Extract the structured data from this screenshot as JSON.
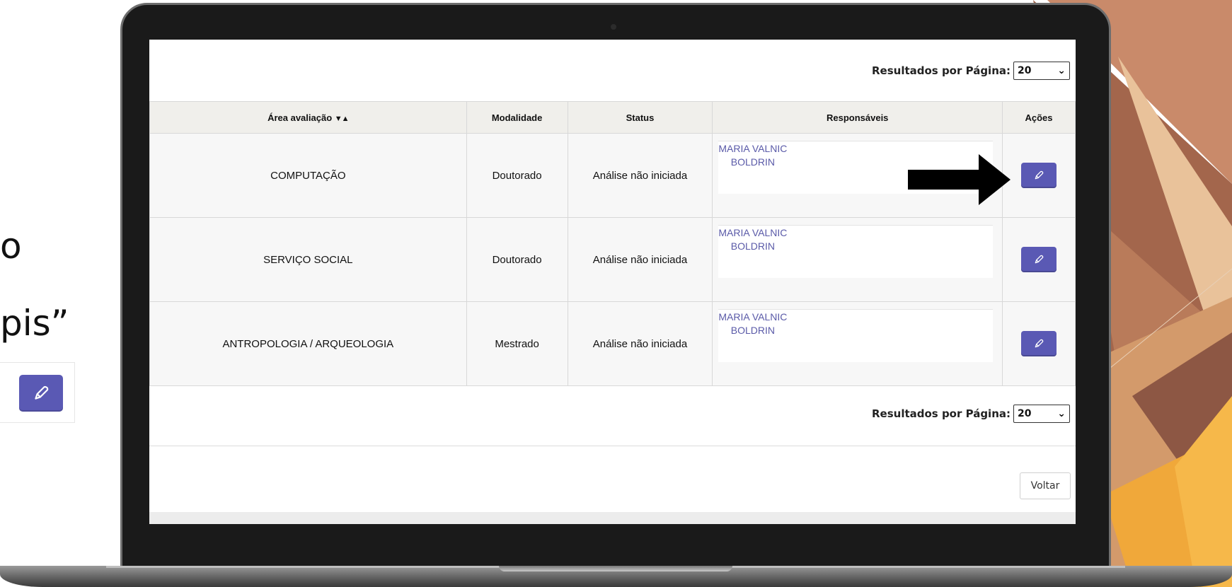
{
  "slide": {
    "fragment_1": "o",
    "fragment_2": "pis”",
    "edit_icon": "pencil-icon"
  },
  "screen": {
    "results_per_page_label": "Resultados por Página:",
    "results_per_page_value": "20",
    "columns": {
      "area": "Área avaliação",
      "sort_icons": "▼▲",
      "modalidade": "Modalidade",
      "status": "Status",
      "responsaveis": "Responsáveis",
      "acoes": "Ações"
    },
    "rows": [
      {
        "area": "COMPUTAÇÃO",
        "modalidade": "Doutorado",
        "status": "Análise não iniciada",
        "responsavel": "MARIA VALNIC\nBOLDRIN"
      },
      {
        "area": "SERVIÇO SOCIAL",
        "modalidade": "Doutorado",
        "status": "Análise não iniciada",
        "responsavel": "MARIA VALNIC\nBOLDRIN"
      },
      {
        "area": "ANTROPOLOGIA / ARQUEOLOGIA",
        "modalidade": "Mestrado",
        "status": "Análise não iniciada",
        "responsavel": "MARIA VALNIC\nBOLDRIN"
      }
    ],
    "voltar_label": "Voltar"
  },
  "colors": {
    "accent_button": "#5a59b4",
    "link_text": "#5a5aa8",
    "header_bg": "#f0efeb"
  }
}
